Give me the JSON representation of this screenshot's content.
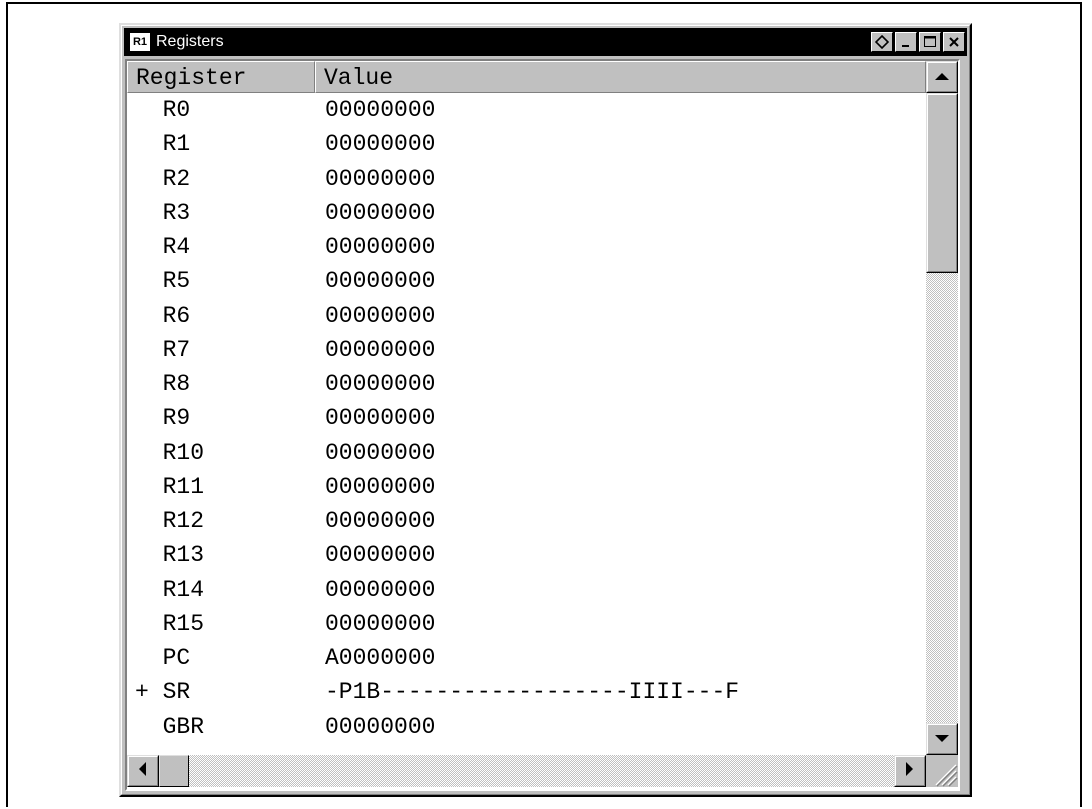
{
  "window": {
    "icon_label": "R1",
    "title": "Registers"
  },
  "table": {
    "headers": {
      "register": "Register",
      "value": "Value"
    },
    "rows": [
      {
        "register": "  R0",
        "value": "00000000"
      },
      {
        "register": "  R1",
        "value": "00000000"
      },
      {
        "register": "  R2",
        "value": "00000000"
      },
      {
        "register": "  R3",
        "value": "00000000"
      },
      {
        "register": "  R4",
        "value": "00000000"
      },
      {
        "register": "  R5",
        "value": "00000000"
      },
      {
        "register": "  R6",
        "value": "00000000"
      },
      {
        "register": "  R7",
        "value": "00000000"
      },
      {
        "register": "  R8",
        "value": "00000000"
      },
      {
        "register": "  R9",
        "value": "00000000"
      },
      {
        "register": "  R10",
        "value": "00000000"
      },
      {
        "register": "  R11",
        "value": "00000000"
      },
      {
        "register": "  R12",
        "value": "00000000"
      },
      {
        "register": "  R13",
        "value": "00000000"
      },
      {
        "register": "  R14",
        "value": "00000000"
      },
      {
        "register": "  R15",
        "value": "00000000"
      },
      {
        "register": "  PC",
        "value": "A0000000"
      },
      {
        "register": "+ SR",
        "value": "-P1B------------------IIII---F"
      },
      {
        "register": "  GBR",
        "value": "00000000"
      }
    ]
  }
}
